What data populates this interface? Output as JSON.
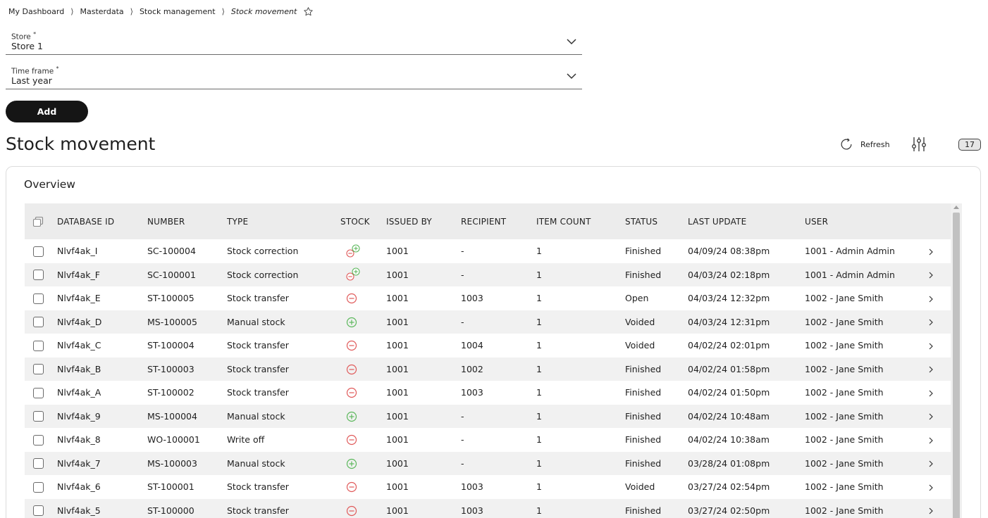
{
  "breadcrumb": {
    "items": [
      "My Dashboard",
      "Masterdata",
      "Stock management"
    ],
    "current": "Stock movement",
    "separator": "⟩"
  },
  "form": {
    "store": {
      "label": "Store",
      "required_mark": "*",
      "value": "Store 1"
    },
    "timeframe": {
      "label": "Time frame",
      "required_mark": "*",
      "value": "Last year"
    },
    "add_label": "Add"
  },
  "page": {
    "title": "Stock movement",
    "refresh_label": "Refresh",
    "count": "17"
  },
  "overview": {
    "title": "Overview",
    "columns": [
      "DATABASE ID",
      "NUMBER",
      "TYPE",
      "STOCK",
      "ISSUED BY",
      "RECIPIENT",
      "ITEM COUNT",
      "STATUS",
      "LAST UPDATE",
      "USER"
    ],
    "rows": [
      {
        "db_id": "Nlvf4ak_I",
        "number": "SC-100004",
        "type": "Stock correction",
        "stock": "minus-plus-icon",
        "issued_by": "1001",
        "recipient": "-",
        "item_count": "1",
        "status": "Finished",
        "last_update": "04/09/24 08:38pm",
        "user": "1001 - Admin Admin"
      },
      {
        "db_id": "Nlvf4ak_F",
        "number": "SC-100001",
        "type": "Stock correction",
        "stock": "minus-plus-icon",
        "issued_by": "1001",
        "recipient": "-",
        "item_count": "1",
        "status": "Finished",
        "last_update": "04/03/24 02:18pm",
        "user": "1001 - Admin Admin"
      },
      {
        "db_id": "Nlvf4ak_E",
        "number": "ST-100005",
        "type": "Stock transfer",
        "stock": "minus-icon",
        "issued_by": "1001",
        "recipient": "1003",
        "item_count": "1",
        "status": "Open",
        "last_update": "04/03/24 12:32pm",
        "user": "1002 - Jane Smith"
      },
      {
        "db_id": "Nlvf4ak_D",
        "number": "MS-100005",
        "type": "Manual stock",
        "stock": "plus-icon",
        "issued_by": "1001",
        "recipient": "-",
        "item_count": "1",
        "status": "Voided",
        "last_update": "04/03/24 12:31pm",
        "user": "1002 - Jane Smith"
      },
      {
        "db_id": "Nlvf4ak_C",
        "number": "ST-100004",
        "type": "Stock transfer",
        "stock": "minus-icon",
        "issued_by": "1001",
        "recipient": "1004",
        "item_count": "1",
        "status": "Voided",
        "last_update": "04/02/24 02:01pm",
        "user": "1002 - Jane Smith"
      },
      {
        "db_id": "Nlvf4ak_B",
        "number": "ST-100003",
        "type": "Stock transfer",
        "stock": "minus-icon",
        "issued_by": "1001",
        "recipient": "1002",
        "item_count": "1",
        "status": "Finished",
        "last_update": "04/02/24 01:58pm",
        "user": "1002 - Jane Smith"
      },
      {
        "db_id": "Nlvf4ak_A",
        "number": "ST-100002",
        "type": "Stock transfer",
        "stock": "minus-icon",
        "issued_by": "1001",
        "recipient": "1003",
        "item_count": "1",
        "status": "Finished",
        "last_update": "04/02/24 01:50pm",
        "user": "1002 - Jane Smith"
      },
      {
        "db_id": "Nlvf4ak_9",
        "number": "MS-100004",
        "type": "Manual stock",
        "stock": "plus-icon",
        "issued_by": "1001",
        "recipient": "-",
        "item_count": "1",
        "status": "Finished",
        "last_update": "04/02/24 10:48am",
        "user": "1002 - Jane Smith"
      },
      {
        "db_id": "Nlvf4ak_8",
        "number": "WO-100001",
        "type": "Write off",
        "stock": "minus-icon",
        "issued_by": "1001",
        "recipient": "-",
        "item_count": "1",
        "status": "Finished",
        "last_update": "04/02/24 10:38am",
        "user": "1002 - Jane Smith"
      },
      {
        "db_id": "Nlvf4ak_7",
        "number": "MS-100003",
        "type": "Manual stock",
        "stock": "plus-icon",
        "issued_by": "1001",
        "recipient": "-",
        "item_count": "1",
        "status": "Finished",
        "last_update": "03/28/24 01:08pm",
        "user": "1002 - Jane Smith"
      },
      {
        "db_id": "Nlvf4ak_6",
        "number": "ST-100001",
        "type": "Stock transfer",
        "stock": "minus-icon",
        "issued_by": "1001",
        "recipient": "1003",
        "item_count": "1",
        "status": "Voided",
        "last_update": "03/27/24 02:54pm",
        "user": "1002 - Jane Smith"
      },
      {
        "db_id": "Nlvf4ak_5",
        "number": "ST-100000",
        "type": "Stock transfer",
        "stock": "minus-icon",
        "issued_by": "1001",
        "recipient": "1003",
        "item_count": "1",
        "status": "Finished",
        "last_update": "03/27/24 02:50pm",
        "user": "1002 - Jane Smith"
      }
    ]
  },
  "colors": {
    "minus": "#e05a5a",
    "plus": "#5cb85c",
    "button_bg": "#151515"
  }
}
